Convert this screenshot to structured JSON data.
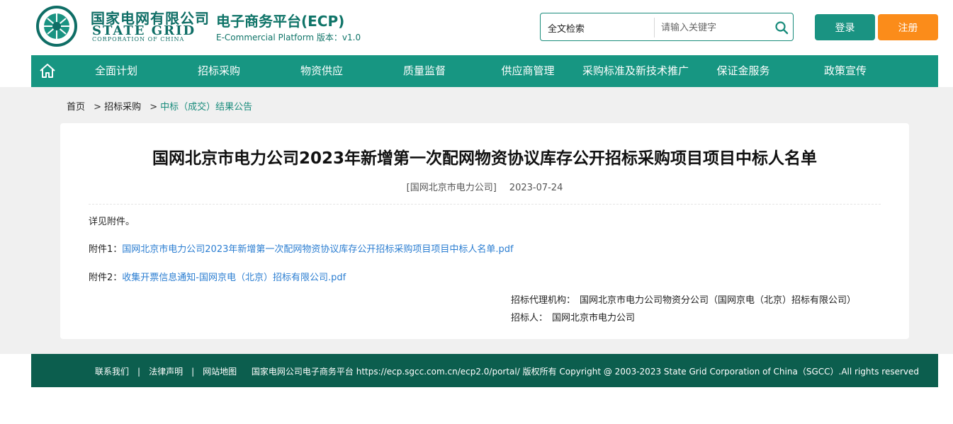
{
  "header": {
    "logo_cn": "国家电网有限公司",
    "logo_en": "STATE GRID",
    "logo_en_sub": "CORPORATION OF CHINA",
    "platform_title": "电子商务平台(ECP)",
    "platform_sub": "E-Commercial Platform 版本：v1.0",
    "search": {
      "type_label": "全文检索",
      "placeholder": "请输入关键字",
      "icon": "search-icon"
    },
    "login_label": "登录",
    "register_label": "注册",
    "colors": {
      "brand": "#179682",
      "login": "#1a9382",
      "register": "#fb8c1a",
      "footer": "#0c5e4e"
    }
  },
  "nav": {
    "home_icon": "home-icon",
    "items": [
      {
        "label": "全面计划"
      },
      {
        "label": "招标采购"
      },
      {
        "label": "物资供应"
      },
      {
        "label": "质量监督"
      },
      {
        "label": "供应商管理"
      },
      {
        "label": "采购标准及新技术推广"
      },
      {
        "label": "保证金服务"
      },
      {
        "label": "政策宣传"
      }
    ]
  },
  "breadcrumb": {
    "home": "首页",
    "level1": "招标采购",
    "current": "中标（成交）结果公告",
    "separator": ">"
  },
  "article": {
    "title": "国网北京市电力公司2023年新增第一次配网物资协议库存公开招标采购项目项目中标人名单",
    "source": "[国网北京市电力公司]",
    "date": "2023-07-24",
    "body": "详见附件。",
    "attachments": [
      {
        "label": "附件1：",
        "name": "国网北京市电力公司2023年新增第一次配网物资协议库存公开招标采购项目项目中标人名单.pdf"
      },
      {
        "label": "附件2：",
        "name": "收集开票信息通知-国网京电（北京）招标有限公司.pdf"
      }
    ],
    "agency_label": "招标代理机构：",
    "agency_value": "国网北京市电力公司物资分公司（国网京电（北京）招标有限公司）",
    "tenderer_label": "招标人：",
    "tenderer_value": "国网北京市电力公司"
  },
  "footer": {
    "links": [
      "联系我们",
      "法律声明",
      "网站地图"
    ],
    "copyright": "国家电网公司电子商务平台 https://ecp.sgcc.com.cn/ecp2.0/portal/ 版权所有 Copyright @ 2003-2023 State Grid Corporation of China（SGCC）.All rights reserved"
  }
}
